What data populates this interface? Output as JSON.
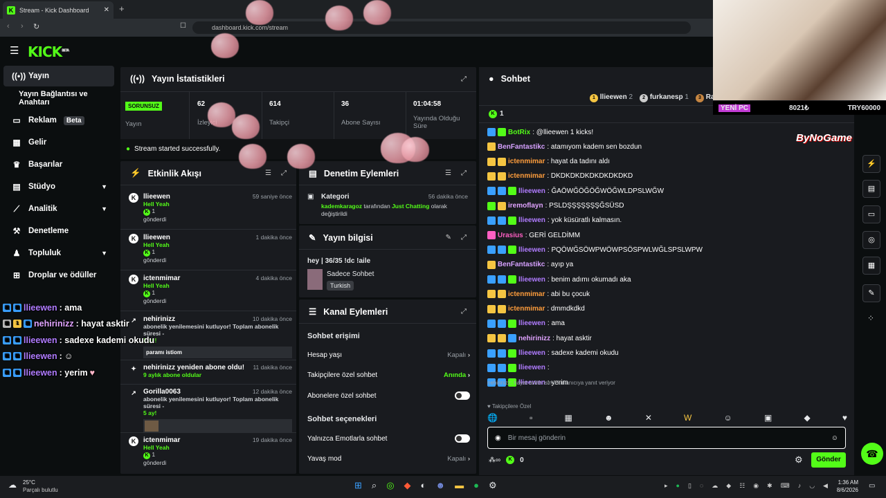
{
  "browser": {
    "tab_title": "Stream - Kick Dashboard",
    "url": "dashboard.kick.com/stream"
  },
  "brand": {
    "logo": "KICK",
    "logo_beta": "BETA",
    "accent": "#53fc18"
  },
  "sidebar": {
    "items": [
      {
        "label": "Yayın",
        "icon": "broadcast-icon"
      },
      {
        "label": "Yayın Bağlantısı ve Anahtarı"
      },
      {
        "label": "Reklam",
        "badge": "Beta",
        "icon": "tv-icon"
      },
      {
        "label": "Gelir",
        "icon": "chart-icon"
      },
      {
        "label": "Başarılar",
        "icon": "trophy-icon"
      },
      {
        "label": "Stüdyo",
        "icon": "grid-icon"
      },
      {
        "label": "Analitik",
        "icon": "analytics-icon"
      },
      {
        "label": "Denetleme",
        "icon": "hammer-icon"
      },
      {
        "label": "Topluluk",
        "icon": "users-icon"
      },
      {
        "label": "Droplar ve ödüller",
        "icon": "gift-icon"
      }
    ]
  },
  "stats": {
    "title": "Yayın İstatistikleri",
    "status": "SORUNSUZ",
    "status_label": "Yayın",
    "cells": [
      {
        "value": "62",
        "label": "İzleyici"
      },
      {
        "value": "614",
        "label": "Takipçi"
      },
      {
        "value": "36",
        "label": "Abone Sayısı"
      },
      {
        "value": "01:04:58",
        "label": "Yayında Olduğu Süre"
      }
    ],
    "success": "Stream started successfully."
  },
  "activity": {
    "title": "Etkinlik Akışı",
    "events": [
      {
        "name": "llieewen",
        "time": "59 saniye önce",
        "sub": "Hell Yeah",
        "count": "1",
        "sent": "gönderdi"
      },
      {
        "name": "llieewen",
        "time": "1 dakika önce",
        "sub": "Hell Yeah",
        "count": "1",
        "sent": "gönderdi"
      },
      {
        "name": "ictenmimar",
        "time": "4 dakika önce",
        "sub": "Hell Yeah",
        "count": "1",
        "sent": "gönderdi"
      },
      {
        "name": "nehirinizz",
        "time": "10 dakika önce",
        "text": "abonelik yenilemesini kutluyor! Toplam abonelik süresi -",
        "months": "9 ay!",
        "msg": "paramı istiom"
      },
      {
        "name": "nehirinizz yeniden abone oldu!",
        "time": "11 dakika önce",
        "text2": "9 aylık abone oldular"
      },
      {
        "name": "Gorilla0063",
        "time": "12 dakika önce",
        "text": "abonelik yenilemesini kutluyor! Toplam abonelik süresi -",
        "months": "5 ay!"
      },
      {
        "name": "ictenmimar",
        "time": "19 dakika önce",
        "sub": "Hell Yeah",
        "count": "1",
        "sent": "gönderdi"
      }
    ]
  },
  "moderation": {
    "title": "Denetim Eylemleri",
    "item": {
      "title": "Kategori",
      "time": "56 dakika önce",
      "user": "kademkaragoz",
      "mid": " tarafından ",
      "cat": "Just Chatting",
      "end": " olarak değiştirildi"
    }
  },
  "info": {
    "title": "Yayın bilgisi",
    "stream_title": "hey | 36/35 !dc !aile",
    "category": "Sadece Sohbet",
    "tag": "Turkish"
  },
  "channel": {
    "title": "Kanal Eylemleri",
    "section1": "Sohbet erişimi",
    "rows": [
      {
        "label": "Hesap yaşı",
        "value": "Kapalı"
      },
      {
        "label": "Takipçilere özel sohbet",
        "value": "Anında"
      },
      {
        "label": "Abonelere özel sohbet"
      }
    ],
    "section2": "Sohbet seçenekleri",
    "rows2": [
      {
        "label": "Yalnızca Emotlarla sohbet"
      },
      {
        "label": "Yavaş mod",
        "value": "Kapalı"
      }
    ]
  },
  "chat": {
    "title": "Sohbet",
    "top": [
      {
        "rank": "1",
        "name": "llieewen",
        "count": "2"
      },
      {
        "name": "furkanesp",
        "count": "1"
      },
      {
        "rank": "3",
        "name": "Ravenn"
      }
    ],
    "kicks": "1",
    "messages": [
      {
        "user": "BotRix",
        "color": "#53fc18",
        "text": ": @llieewen 1 kicks!"
      },
      {
        "user": "BenFantastikc",
        "color": "#d6a1ff",
        "text": ": atamıyom kadem sen bozdun",
        "b": "15"
      },
      {
        "user": "ictenmimar",
        "color": "#ff9d3c",
        "text": ": hayat da tadını aldı"
      },
      {
        "user": "ictenmimar",
        "color": "#ff9d3c",
        "text": ": DKDKDKDKDKDKDKDKD"
      },
      {
        "user": "llieewen",
        "color": "#b07cff",
        "text": ": ĞAÖWĞÖĞÖĞWÖĞWLDPSLWĞW"
      },
      {
        "user": "iremoflayn",
        "color": "#e0a3ff",
        "text": ": PSLDŞŞŞŞŞŞŞĞSÜSD"
      },
      {
        "user": "llieewen",
        "color": "#b07cff",
        "text": ": yok küsüratlı kalmasın."
      },
      {
        "user": "Urasius",
        "color": "#ff5fc3",
        "text": ": GERİ GELDİMM"
      },
      {
        "user": "llieewen",
        "color": "#b07cff",
        "text": ": PQÖWĞSÖWPWÖWPSÖSPWLWĞLSPSLWPW"
      },
      {
        "user": "BenFantastikc",
        "color": "#d6a1ff",
        "text": ": ayıp ya"
      },
      {
        "user": "llieewen",
        "color": "#b07cff",
        "text": ": benim adımı okumadı aka"
      },
      {
        "user": "ictenmimar",
        "color": "#ff9d3c",
        "text": ": abi bu çocuk"
      },
      {
        "user": "ictenmimar",
        "color": "#ff9d3c",
        "text": ": dmmdkdkd"
      },
      {
        "user": "llieewen",
        "color": "#b07cff",
        "text": ": ama"
      },
      {
        "user": "nehirinizz",
        "color": "#e0a3ff",
        "text": ": hayat asktir"
      },
      {
        "user": "llieewen",
        "color": "#b07cff",
        "text": ": sadexe kademi okudu"
      },
      {
        "user": "llieewen",
        "color": "#b07cff",
        "text": ":"
      },
      {
        "user": "llieewen",
        "color": "#b07cff",
        "text": ": yerim"
      }
    ],
    "reply_note": "nehirinizz: hayat asktir isimli kullanıcıya yanıt veriyor",
    "followers_only": "Takipçilere Özel",
    "placeholder": "Bir mesaj gönderin",
    "kick_count": "0",
    "send": "Gönder"
  },
  "overlay": {
    "lines": [
      {
        "user": "llieewen",
        "text": " : ama"
      },
      {
        "user": "nehirinizz",
        "text": " : hayat asktir"
      },
      {
        "user": "llieewen",
        "text": " : sadexe kademi okudu"
      },
      {
        "user": "llieewen",
        "text": " :"
      },
      {
        "user": "llieewen",
        "text": " : yerim"
      }
    ],
    "cam_bar": {
      "label": "YENİ PC",
      "amount": "8021₺",
      "target": "TRY60000"
    },
    "sponsor": "ByNoGame"
  },
  "taskbar": {
    "weather_temp": "25°C",
    "weather_desc": "Parçalı bulutlu",
    "time": "1:36 AM",
    "date": "8/6/2026"
  }
}
